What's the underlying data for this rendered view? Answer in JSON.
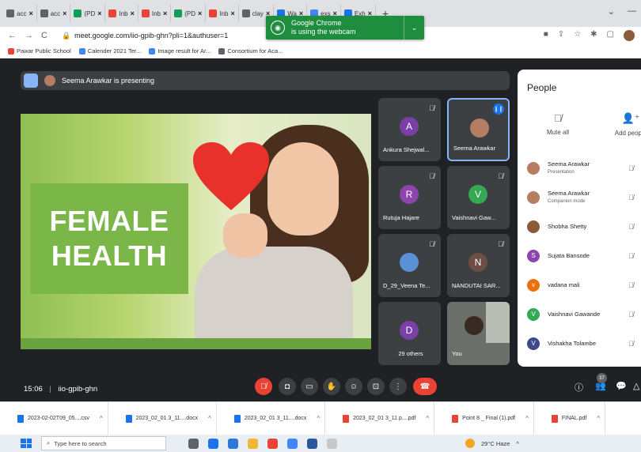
{
  "browser": {
    "tabs": [
      {
        "label": "acc",
        "color": "#5f6368"
      },
      {
        "label": "acc",
        "color": "#5f6368"
      },
      {
        "label": "(PD",
        "color": "#0f9d58"
      },
      {
        "label": "Inb",
        "color": "#ea4335"
      },
      {
        "label": "Inb",
        "color": "#ea4335"
      },
      {
        "label": "(PD",
        "color": "#0f9d58"
      },
      {
        "label": "Inb",
        "color": "#ea4335"
      },
      {
        "label": "clay",
        "color": "#5f6368"
      },
      {
        "label": "Wa",
        "color": "#1a73e8"
      },
      {
        "label": "exs",
        "color": "#4285f4"
      },
      {
        "label": "Exh",
        "color": "#1a73e8"
      }
    ],
    "new_tab": "+",
    "url": "meet.google.com/iio-gpib-ghn?pli=1&authuser=1",
    "bookmarks": [
      {
        "label": "Pawar Public School",
        "color": "#ea4335"
      },
      {
        "label": "Calender 2021 Ter...",
        "color": "#4285f4"
      },
      {
        "label": "Image result for Ar...",
        "color": "#4285f4"
      },
      {
        "label": "Consortium for Aca...",
        "color": "#5f6368"
      }
    ],
    "toast_line1": "Google Chrome",
    "toast_line2": "is using the webcam"
  },
  "meet": {
    "presenting_label": "Seema Arawkar is presenting",
    "slide_title_line1": "FEMALE",
    "slide_title_line2": "HEALTH",
    "tiles": [
      {
        "name": "Ankura Shejwal...",
        "initial": "A",
        "color": "#7b3fa8"
      },
      {
        "name": "Seema Arawkar",
        "initial": "",
        "color": "#b57e62"
      },
      {
        "name": "Rutuja Hajare",
        "initial": "R",
        "color": "#8e44ad"
      },
      {
        "name": "Vaishnavi Gaw...",
        "initial": "V",
        "color": "#34a853"
      },
      {
        "name": "D_29_Veena Te...",
        "initial": "",
        "color": "#5b8fd6"
      },
      {
        "name": "NANDUTAI SAR...",
        "initial": "N",
        "color": "#6d4c41"
      },
      {
        "name": "29 others",
        "initial": "D",
        "color": "#7b3fa8"
      },
      {
        "name": "You",
        "initial": "",
        "color": "#6b6f6a"
      }
    ],
    "people_panel": {
      "title": "People",
      "mute_all": "Mute all",
      "add_people": "Add people",
      "list": [
        {
          "name": "Seema Arawkar",
          "sub": "Presentation",
          "initial": "",
          "color": "#b57e62"
        },
        {
          "name": "Seema Arawkar",
          "sub": "Companion mode",
          "initial": "",
          "color": "#b57e62"
        },
        {
          "name": "Shobha Shetty",
          "sub": "",
          "initial": "",
          "color": "#8a5a3c"
        },
        {
          "name": "Sujata Bansode",
          "sub": "",
          "initial": "S",
          "color": "#8e44ad"
        },
        {
          "name": "vadana mali",
          "sub": "",
          "initial": "v",
          "color": "#e8710a"
        },
        {
          "name": "Vaishnavi Gawande",
          "sub": "",
          "initial": "V",
          "color": "#34a853"
        },
        {
          "name": "Vishakha Tolambe",
          "sub": "",
          "initial": "V",
          "color": "#3c4a8a"
        }
      ]
    },
    "time": "15:06",
    "meeting_code": "iio-gpib-ghn",
    "participants_badge": "37"
  },
  "downloads": [
    {
      "name": "2023-02-02T09_05....csv",
      "color": "#1a73e8"
    },
    {
      "name": "2023_02_01 3_11....docx",
      "color": "#1a73e8"
    },
    {
      "name": "2023_02_01 3_11....docx",
      "color": "#1a73e8"
    },
    {
      "name": "2023_02_01 3_11 p....pdf",
      "color": "#ea4335"
    },
    {
      "name": "Point 8 _ Final (1).pdf",
      "color": "#ea4335"
    },
    {
      "name": "FINAL.pdf",
      "color": "#ea4335"
    }
  ],
  "taskbar": {
    "search_placeholder": "Type here to search",
    "weather": "29°C Haze"
  }
}
